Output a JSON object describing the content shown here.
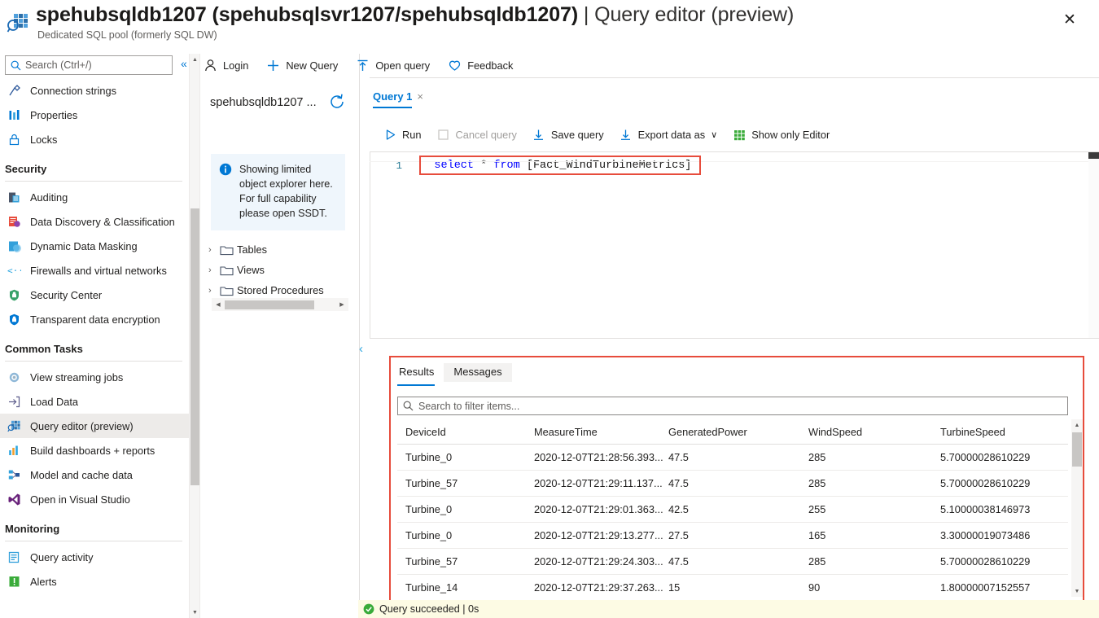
{
  "header": {
    "title_bold": "spehubsqldb1207 (spehubsqlsvr1207/spehubsqldb1207)",
    "title_light": " | Query editor (preview)",
    "subtitle": "Dedicated SQL pool (formerly SQL DW)",
    "close_label": "✕",
    "icon": "query-editor-icon"
  },
  "sidebar": {
    "search_placeholder": "Search (Ctrl+/)",
    "collapse_label": "«",
    "items": [
      {
        "label": "Connection strings",
        "icon": "plug-icon",
        "selected": false
      },
      {
        "label": "Properties",
        "icon": "properties-icon",
        "selected": false
      },
      {
        "label": "Locks",
        "icon": "lock-icon",
        "selected": false
      }
    ],
    "groups": [
      {
        "title": "Security",
        "items": [
          {
            "label": "Auditing",
            "icon": "auditing-icon",
            "selected": false
          },
          {
            "label": "Data Discovery & Classification",
            "icon": "data-discovery-icon",
            "selected": false
          },
          {
            "label": "Dynamic Data Masking",
            "icon": "data-masking-icon",
            "selected": false
          },
          {
            "label": "Firewalls and virtual networks",
            "icon": "firewall-icon",
            "selected": false
          },
          {
            "label": "Security Center",
            "icon": "shield-icon",
            "selected": false
          },
          {
            "label": "Transparent data encryption",
            "icon": "encryption-icon",
            "selected": false
          }
        ]
      },
      {
        "title": "Common Tasks",
        "items": [
          {
            "label": "View streaming jobs",
            "icon": "streaming-jobs-icon",
            "selected": false
          },
          {
            "label": "Load Data",
            "icon": "load-data-icon",
            "selected": false
          },
          {
            "label": "Query editor (preview)",
            "icon": "query-editor-icon",
            "selected": true
          },
          {
            "label": "Build dashboards + reports",
            "icon": "dashboard-icon",
            "selected": false
          },
          {
            "label": "Model and cache data",
            "icon": "model-cache-icon",
            "selected": false
          },
          {
            "label": "Open in Visual Studio",
            "icon": "visual-studio-icon",
            "selected": false
          }
        ]
      },
      {
        "title": "Monitoring",
        "items": [
          {
            "label": "Query activity",
            "icon": "query-activity-icon",
            "selected": false
          },
          {
            "label": "Alerts",
            "icon": "alerts-icon",
            "selected": false
          }
        ]
      }
    ]
  },
  "command_bar": {
    "items": [
      {
        "label": "Login",
        "icon": "person-icon"
      },
      {
        "label": "New Query",
        "icon": "plus-icon"
      },
      {
        "label": "Open query",
        "icon": "upload-arrow-icon"
      },
      {
        "label": "Feedback",
        "icon": "heart-icon"
      }
    ]
  },
  "object_explorer": {
    "db_name": "spehubsqldb1207 ...",
    "refresh_icon": "refresh-icon",
    "info_icon": "info-icon",
    "info_text": "Showing limited object explorer here. For full capability please open SSDT.",
    "tree": [
      {
        "label": "Tables",
        "icon": "folder-icon",
        "caret": "›"
      },
      {
        "label": "Views",
        "icon": "folder-icon",
        "caret": "›"
      },
      {
        "label": "Stored Procedures",
        "icon": "folder-icon",
        "caret": "›"
      }
    ]
  },
  "query_tab": {
    "label": "Query 1",
    "close": "×"
  },
  "editor_toolbar": {
    "items": [
      {
        "label": "Run",
        "icon": "play-icon",
        "disabled": false
      },
      {
        "label": "Cancel query",
        "icon": "stop-square-icon",
        "disabled": true
      },
      {
        "label": "Save query",
        "icon": "download-arrow-icon",
        "disabled": false
      },
      {
        "label": "Export data as",
        "icon": "download-arrow-icon",
        "disabled": false,
        "chevron": "∨"
      },
      {
        "label": "Show only Editor",
        "icon": "grid-icon",
        "disabled": false
      }
    ]
  },
  "editor": {
    "line_number": "1",
    "sql_keyword_select": "select",
    "sql_star": "*",
    "sql_keyword_from": "from",
    "sql_table": "[Fact_WindTurbineMetrics]",
    "highlight_color": "#e74c3c"
  },
  "results": {
    "tabs": [
      {
        "label": "Results",
        "active": true
      },
      {
        "label": "Messages",
        "active": false
      }
    ],
    "filter_placeholder": "Search to filter items...",
    "columns": [
      "DeviceId",
      "MeasureTime",
      "GeneratedPower",
      "WindSpeed",
      "TurbineSpeed"
    ],
    "rows": [
      [
        "Turbine_0",
        "2020-12-07T21:28:56.393...",
        "47.5",
        "285",
        "5.70000028610229"
      ],
      [
        "Turbine_57",
        "2020-12-07T21:29:11.137...",
        "47.5",
        "285",
        "5.70000028610229"
      ],
      [
        "Turbine_0",
        "2020-12-07T21:29:01.363...",
        "42.5",
        "255",
        "5.10000038146973"
      ],
      [
        "Turbine_0",
        "2020-12-07T21:29:13.277...",
        "27.5",
        "165",
        "3.30000019073486"
      ],
      [
        "Turbine_57",
        "2020-12-07T21:29:24.303...",
        "47.5",
        "285",
        "5.70000028610229"
      ],
      [
        "Turbine_14",
        "2020-12-07T21:29:37.263...",
        "15",
        "90",
        "1.80000007152557"
      ]
    ]
  },
  "status_bar": {
    "text": "Query succeeded | 0s",
    "icon": "success-check-icon",
    "background": "#fdfbe4"
  },
  "colors": {
    "accent": "#0078d4",
    "highlight": "#e74c3c",
    "success": "#3aab3a",
    "sidebar_selected": "#edebe9"
  }
}
